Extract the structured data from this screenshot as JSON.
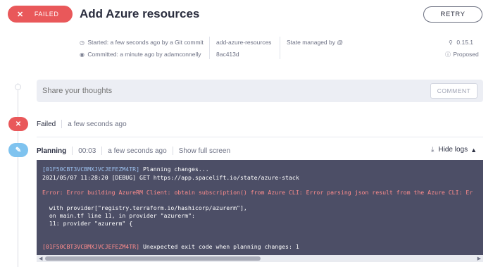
{
  "header": {
    "status": "FAILED",
    "title": "Add Azure resources",
    "retry_label": "RETRY",
    "started": "Started: a few seconds ago by a Git commit",
    "committed": "Committed: a minute ago by adamconnelly",
    "branch": "add-azure-resources",
    "commit_hash": "8ac413d",
    "state_managed": "State managed by @",
    "version": "0.15.1",
    "proposed": "Proposed"
  },
  "comment": {
    "placeholder": "Share your thoughts",
    "button_label": "COMMENT"
  },
  "timeline": {
    "failed": {
      "label": "Failed",
      "time": "a few seconds ago"
    },
    "planning": {
      "label": "Planning",
      "duration": "00:03",
      "time": "a few seconds ago",
      "fullscreen": "Show full screen",
      "hide_logs": "Hide logs"
    }
  },
  "logs": {
    "line1_id": "[01F50CBT3VCBMXJVCJEFEZM4TR]",
    "line1_msg": " Planning changes...",
    "line2": "2021/05/07 11:28:20 [DEBUG] GET https://app.spacelift.io/state/azure-stack",
    "line3": "Error: Error building AzureRM Client: obtain subscription() from Azure CLI: Error parsing json result from the Azure CLI: Er",
    "line4": "  with provider[\"registry.terraform.io/hashicorp/azurerm\"],",
    "line5": "  on main.tf line 11, in provider \"azurerm\":",
    "line6": "  11: provider \"azurerm\" {",
    "line7_id": "[01F50CBT3VCBMXJVCJEFEZM4TR]",
    "line7_msg": " Unexpected exit code when planning changes: 1"
  },
  "colors": {
    "failed": "#e9585a",
    "planning": "#7fc3ef",
    "log_bg": "#4c4e66"
  }
}
